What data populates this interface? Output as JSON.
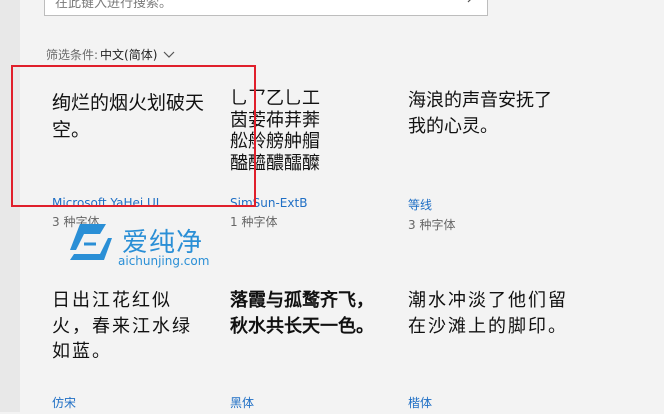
{
  "search": {
    "placeholder": "在此键入进行搜索。"
  },
  "filter": {
    "label": "筛选条件: ",
    "value": "中文(简体)"
  },
  "fonts": [
    {
      "sample": "绚烂的烟火划破天空。",
      "name": "Microsoft YaHei UI",
      "count": "3 种字体"
    },
    {
      "sample": "乚乛乙乚工\n茵荌茽荓莾\n舩舲艕舯艒\n醠醯醲醽醾",
      "name": "SimSun-ExtB",
      "count": "1 种字体"
    },
    {
      "sample": "海浪的声音安抚了我的心灵。",
      "name": "等线",
      "count": "3 种字体"
    },
    {
      "sample": "日出江花红似火，春来江水绿如蓝。",
      "name": "仿宋",
      "count": ""
    },
    {
      "sample": "落霞与孤鹜齐飞，秋水共长天一色。",
      "name": "黑体",
      "count": ""
    },
    {
      "sample": "潮水冲淡了他们留在沙滩上的脚印。",
      "name": "楷体",
      "count": ""
    }
  ],
  "watermark": {
    "logo_text": "爱纯净",
    "url": "aichunjing.com"
  },
  "colors": {
    "selection": "#e01f2b",
    "link": "#1f6fc5",
    "watermark": "#2a8fd6"
  }
}
